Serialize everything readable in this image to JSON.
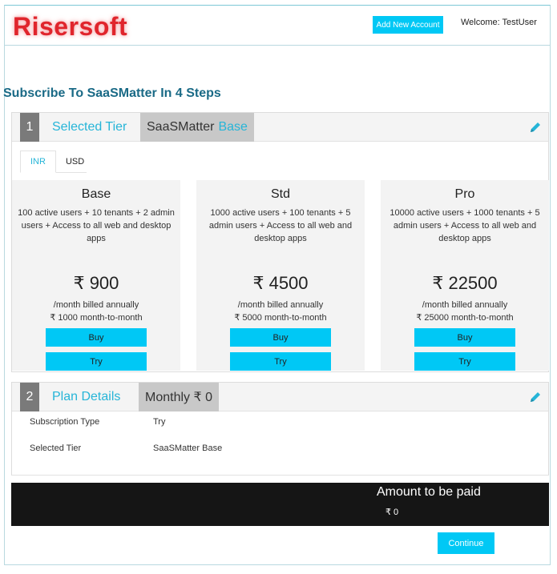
{
  "header": {
    "logo_text": "Risersoft",
    "add_account_label": "Add New Account",
    "welcome_text": "Welcome: TestUser"
  },
  "page_title": "Subscribe To SaaSMatter In 4 Steps",
  "step1": {
    "number": "1",
    "title": "Selected Tier",
    "tag_prefix": "SaaSMatter",
    "tag_value": "Base",
    "currency_tabs": [
      "INR",
      "USD"
    ],
    "active_currency": "INR",
    "plans": [
      {
        "name": "Base",
        "description": "100 active users + 10 tenants + 2 admin users + Access to all web and desktop apps",
        "price": "₹ 900",
        "billed_annual": "/month billed annually",
        "billed_monthly": "₹ 1000 month-to-month",
        "buy_label": "Buy",
        "try_label": "Try"
      },
      {
        "name": "Std",
        "description": "1000 active users + 100 tenants + 5 admin users + Access to all web and desktop apps",
        "price": "₹ 4500",
        "billed_annual": "/month billed annually",
        "billed_monthly": "₹ 5000 month-to-month",
        "buy_label": "Buy",
        "try_label": "Try"
      },
      {
        "name": "Pro",
        "description": "10000 active users + 1000 tenants + 5 admin users + Access to all web and desktop apps",
        "price": "₹ 22500",
        "billed_annual": "/month billed annually",
        "billed_monthly": "₹ 25000 month-to-month",
        "buy_label": "Buy",
        "try_label": "Try"
      }
    ]
  },
  "step2": {
    "number": "2",
    "title": "Plan Details",
    "tag": "Monthly ₹ 0",
    "rows": [
      {
        "label": "Subscription Type",
        "value": "Try"
      },
      {
        "label": "Selected Tier",
        "value": "SaaSMatter Base"
      }
    ]
  },
  "amount": {
    "title": "Amount to be paid",
    "value": "₹ 0"
  },
  "continue_label": "Continue",
  "colors": {
    "accent": "#00c8f5",
    "heading": "#1a6a86",
    "logo": "#e0252c"
  },
  "icons": {
    "edit": "pencil-icon"
  }
}
